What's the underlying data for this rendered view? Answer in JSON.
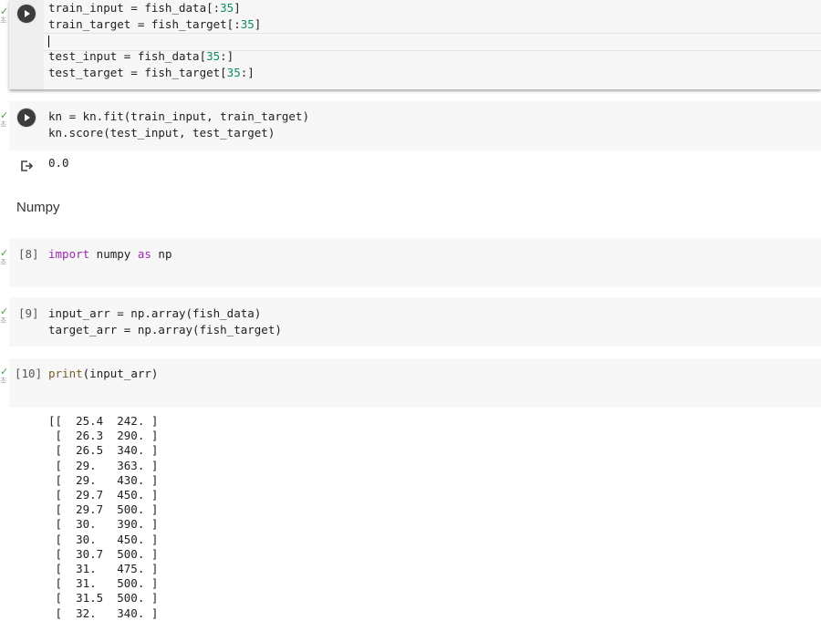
{
  "cells": {
    "split": {
      "gutter_check": "✓",
      "gutter_note": "초",
      "lines": [
        {
          "a": "train_input = fish_data[:",
          "n": "35",
          "b": "]"
        },
        {
          "a": "train_target = fish_target[:",
          "n": "35",
          "b": "]"
        },
        {
          "a": "",
          "n": "",
          "b": ""
        },
        {
          "a": "test_input = fish_data[",
          "n": "35",
          "b": ":]"
        },
        {
          "a": "test_target = fish_target[",
          "n": "35",
          "b": ":]"
        }
      ]
    },
    "fit": {
      "gutter_check": "✓",
      "gutter_note": "초",
      "line1": "kn = kn.fit(train_input, train_target)",
      "line2": "kn.score(test_input, test_target)",
      "output": "0.0"
    },
    "heading": "Numpy",
    "import": {
      "exec": "[8]",
      "gutter_check": "✓",
      "gutter_note": "초",
      "kw1": "import",
      "mod": " numpy ",
      "kw2": "as",
      "alias": " np"
    },
    "arrays": {
      "exec": "[9]",
      "gutter_check": "✓",
      "gutter_note": "초",
      "line1": "input_arr = np.array(fish_data)",
      "line2": "target_arr = np.array(fish_target)"
    },
    "print": {
      "exec": "[10]",
      "gutter_check": "✓",
      "gutter_note": "초",
      "fn": "print",
      "arg": "(input_arr)",
      "output_lines": [
        "[[  25.4  242. ]",
        " [  26.3  290. ]",
        " [  26.5  340. ]",
        " [  29.   363. ]",
        " [  29.   430. ]",
        " [  29.7  450. ]",
        " [  29.7  500. ]",
        " [  30.   390. ]",
        " [  30.   450. ]",
        " [  30.7  500. ]",
        " [  31.   475. ]",
        " [  31.   500. ]",
        " [  31.5  500. ]",
        " [  32.   340. ]"
      ]
    }
  }
}
